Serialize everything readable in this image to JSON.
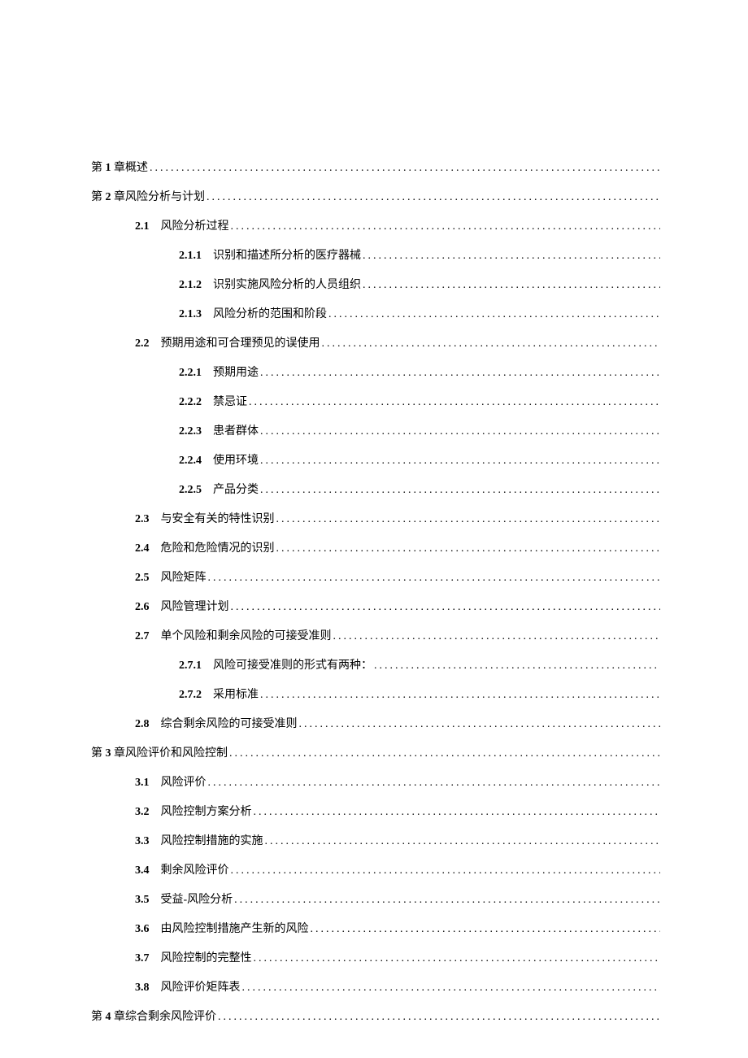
{
  "toc": [
    {
      "level": 0,
      "type": "chapter",
      "prefix": "第 ",
      "num": "1",
      "suffix": " 章概述"
    },
    {
      "level": 0,
      "type": "chapter",
      "prefix": "第 ",
      "num": "2",
      "suffix": " 章风险分析与计划"
    },
    {
      "level": 1,
      "number": "2.1",
      "title": "风险分析过程"
    },
    {
      "level": 2,
      "number": "2.1.1",
      "title": "识别和描述所分析的医疗器械"
    },
    {
      "level": 2,
      "number": "2.1.2",
      "title": "识别实施风险分析的人员组织"
    },
    {
      "level": 2,
      "number": "2.1.3",
      "title": "风险分析的范围和阶段"
    },
    {
      "level": 1,
      "number": "2.2",
      "title": "预期用途和可合理预见的误使用"
    },
    {
      "level": 2,
      "number": "2.2.1",
      "title": "预期用途"
    },
    {
      "level": 2,
      "number": "2.2.2",
      "title": "禁忌证"
    },
    {
      "level": 2,
      "number": "2.2.3",
      "title": "患者群体"
    },
    {
      "level": 2,
      "number": "2.2.4",
      "title": "使用环境"
    },
    {
      "level": 2,
      "number": "2.2.5",
      "title": "产品分类"
    },
    {
      "level": 1,
      "number": "2.3",
      "title": "与安全有关的特性识别"
    },
    {
      "level": 1,
      "number": "2.4",
      "title": "危险和危险情况的识别"
    },
    {
      "level": 1,
      "number": "2.5",
      "title": "风险矩阵"
    },
    {
      "level": 1,
      "number": "2.6",
      "title": "风险管理计划"
    },
    {
      "level": 1,
      "number": "2.7",
      "title": "单个风险和剩余风险的可接受准则"
    },
    {
      "level": 2,
      "number": "2.7.1",
      "title": "风险可接受准则的形式有两种："
    },
    {
      "level": 2,
      "number": "2.7.2",
      "title": "采用标准"
    },
    {
      "level": 1,
      "number": "2.8",
      "title": "综合剩余风险的可接受准则"
    },
    {
      "level": 0,
      "type": "chapter",
      "prefix": "第 ",
      "num": "3",
      "suffix": " 章风险评价和风险控制"
    },
    {
      "level": 1,
      "number": "3.1",
      "title": "风险评价"
    },
    {
      "level": 1,
      "number": "3.2",
      "title": "风险控制方案分析"
    },
    {
      "level": 1,
      "number": "3.3",
      "title": "风险控制措施的实施"
    },
    {
      "level": 1,
      "number": "3.4",
      "title": "剩余风险评价"
    },
    {
      "level": 1,
      "number": "3.5",
      "title": "受益-风险分析"
    },
    {
      "level": 1,
      "number": "3.6",
      "title": "由风险控制措施产生新的风险"
    },
    {
      "level": 1,
      "number": "3.7",
      "title": "风险控制的完整性"
    },
    {
      "level": 1,
      "number": "3.8",
      "title": "风险评价矩阵表"
    },
    {
      "level": 0,
      "type": "chapter",
      "prefix": "第 ",
      "num": "4",
      "suffix": " 章综合剩余风险评价"
    }
  ]
}
